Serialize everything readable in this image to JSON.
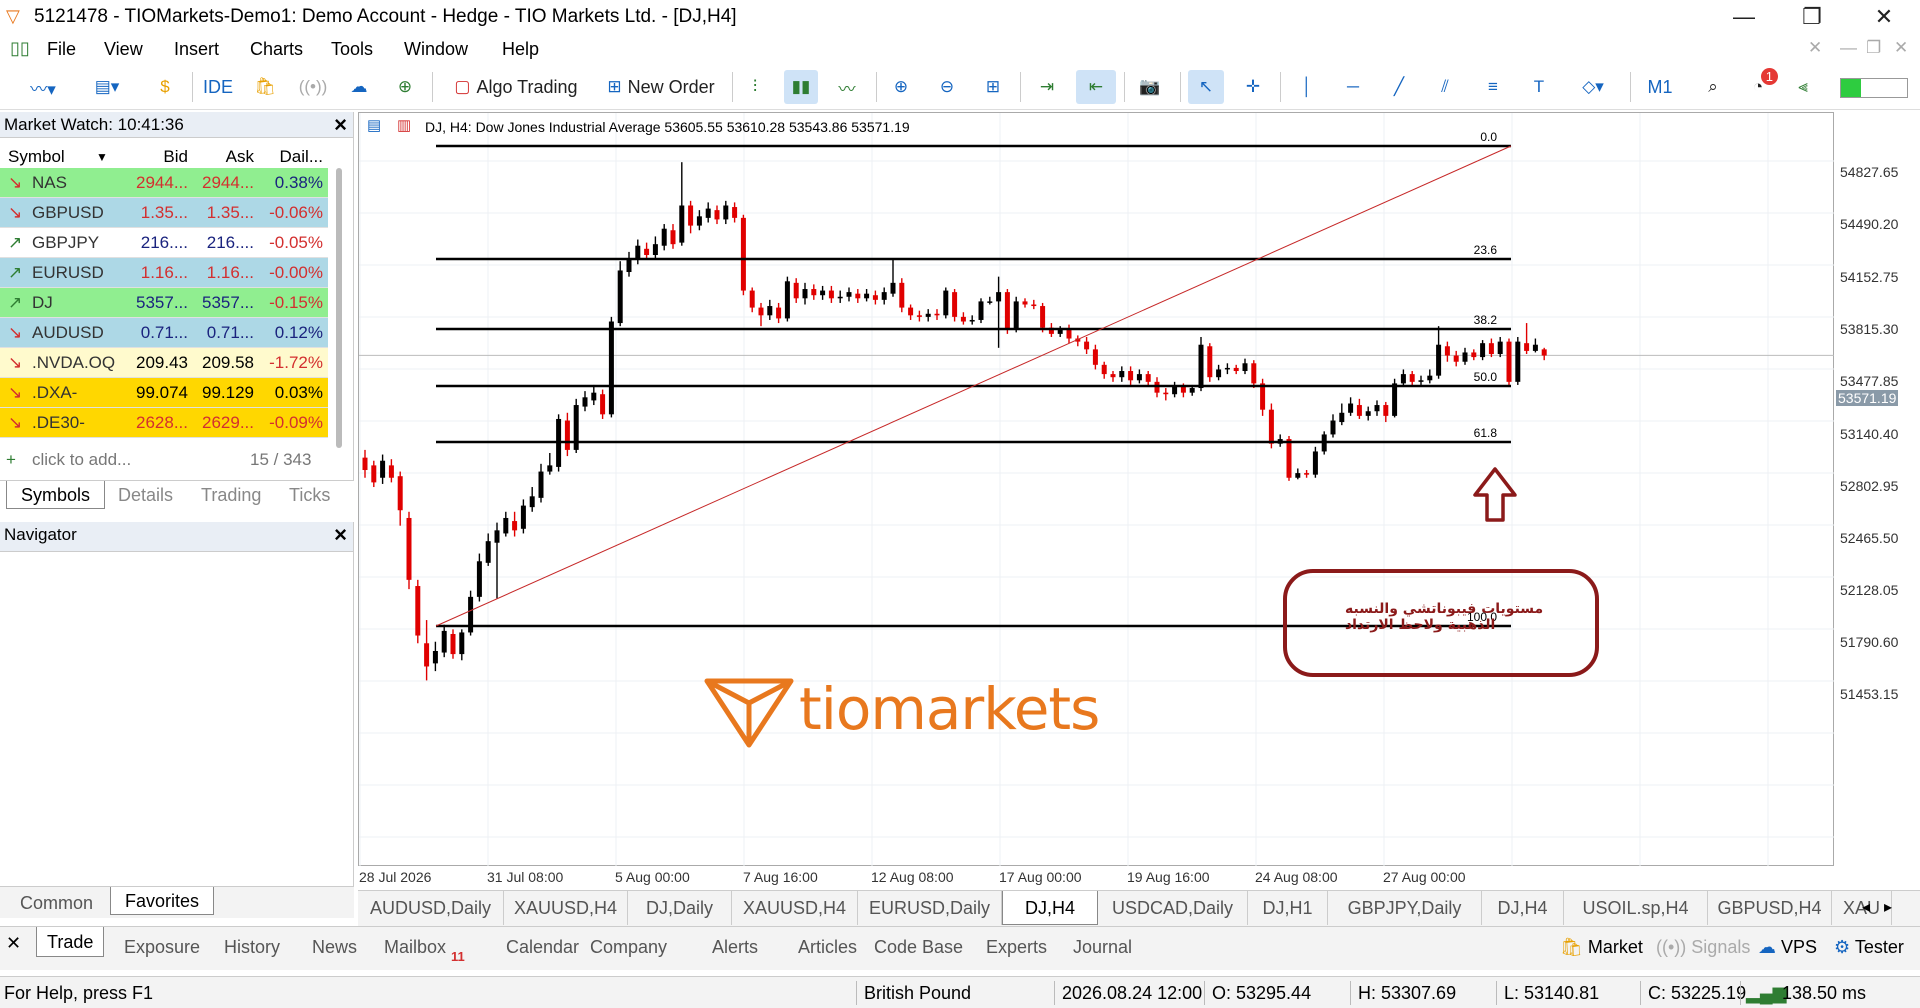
{
  "window": {
    "title": "5121478 - TIOMarkets-Demo1: Demo Account - Hedge - TIO Markets Ltd. - [DJ,H4]"
  },
  "menu": [
    "File",
    "View",
    "Insert",
    "Charts",
    "Tools",
    "Window",
    "Help"
  ],
  "toolbar": {
    "ide_label": "IDE",
    "algo_label": "Algo Trading",
    "new_order_label": "New Order",
    "timeframe": "M1",
    "notif_count": "1"
  },
  "market_watch": {
    "title": "Market Watch: 10:41:36",
    "headers": {
      "symbol": "Symbol",
      "bid": "Bid",
      "ask": "Ask",
      "daily": "Dail..."
    },
    "rows": [
      {
        "symbol": "NAS",
        "bid": "2944...",
        "ask": "2944...",
        "daily": "0.38%",
        "dir": "down",
        "bg": "#90ee90",
        "color": "#d32f2f",
        "dcolor": "#1a237e"
      },
      {
        "symbol": "GBPUSD",
        "bid": "1.35...",
        "ask": "1.35...",
        "daily": "-0.06%",
        "dir": "down",
        "bg": "#add8e6",
        "color": "#d32f2f",
        "dcolor": "#d32f2f"
      },
      {
        "symbol": "GBPJPY",
        "bid": "216....",
        "ask": "216....",
        "daily": "-0.05%",
        "dir": "up",
        "bg": "#ffffff",
        "color": "#1a237e",
        "dcolor": "#d32f2f"
      },
      {
        "symbol": "EURUSD",
        "bid": "1.16...",
        "ask": "1.16...",
        "daily": "-0.00%",
        "dir": "up",
        "bg": "#add8e6",
        "color": "#d32f2f",
        "dcolor": "#d32f2f"
      },
      {
        "symbol": "DJ",
        "bid": "5357...",
        "ask": "5357...",
        "daily": "-0.15%",
        "dir": "up",
        "bg": "#90ee90",
        "color": "#1a237e",
        "dcolor": "#d32f2f"
      },
      {
        "symbol": "AUDUSD",
        "bid": "0.71...",
        "ask": "0.71...",
        "daily": "0.12%",
        "dir": "down",
        "bg": "#add8e6",
        "color": "#1a237e",
        "dcolor": "#1a237e"
      },
      {
        "symbol": ".NVDA.OQ",
        "bid": "209.43",
        "ask": "209.58",
        "daily": "-1.72%",
        "dir": "down",
        "bg": "#fffacd",
        "color": "#000000",
        "dcolor": "#d32f2f"
      },
      {
        "symbol": ".DXA-",
        "bid": "99.074",
        "ask": "99.129",
        "daily": "0.03%",
        "dir": "down",
        "bg": "#ffd700",
        "color": "#000000",
        "dcolor": "#000000"
      },
      {
        "symbol": ".DE30-",
        "bid": "2628...",
        "ask": "2629...",
        "daily": "-0.09%",
        "dir": "down",
        "bg": "#ffd700",
        "color": "#d32f2f",
        "dcolor": "#d32f2f"
      }
    ],
    "add_label": "click to add...",
    "count": "15 / 343",
    "tabs": [
      "Symbols",
      "Details",
      "Trading",
      "Ticks"
    ]
  },
  "navigator": {
    "title": "Navigator",
    "tabs": [
      "Common",
      "Favorites"
    ]
  },
  "chart": {
    "header": "DJ, H4:  Dow Jones Industrial Average  53605.55 53610.28 53543.86 53571.19",
    "price_labels": [
      "54827.65",
      "54490.20",
      "54152.75",
      "53815.30",
      "53477.85",
      "53140.40",
      "52802.95",
      "52465.50",
      "52128.05",
      "51790.60",
      "51453.15"
    ],
    "current_price": "53571.19",
    "time_labels": [
      "28 Jul 2026",
      "31 Jul 08:00",
      "5 Aug 00:00",
      "7 Aug 16:00",
      "12 Aug 08:00",
      "17 Aug 00:00",
      "19 Aug 16:00",
      "24 Aug 08:00",
      "27 Aug 00:00"
    ],
    "fib_levels": [
      "0.0",
      "23.6",
      "38.2",
      "50.0",
      "61.8",
      "100.0"
    ],
    "annotation_line1": "مستويات فيبوناتشي والنسبه",
    "annotation_line2": "الذهبية ولاحظ الارتداد",
    "watermark": "tiomarkets"
  },
  "chart_tabs": [
    "AUDUSD,Daily",
    "XAUUSD,H4",
    "DJ,Daily",
    "XAUUSD,H4",
    "EURUSD,Daily",
    "DJ,H4",
    "USDCAD,Daily",
    "DJ,H1",
    "GBPJPY,Daily",
    "DJ,H4",
    "USOIL.sp,H4",
    "GBPUSD,H4",
    "XAU"
  ],
  "terminal_tabs": [
    "Trade",
    "Exposure",
    "History",
    "News",
    "Mailbox",
    "Calendar",
    "Company",
    "Alerts",
    "Articles",
    "Code Base",
    "Experts",
    "Journal"
  ],
  "mailbox_count": "11",
  "terminal_right": {
    "market": "Market",
    "signals": "Signals",
    "vps": "VPS",
    "tester": "Tester"
  },
  "status": {
    "help": "For Help, press F1",
    "profile": "British Pound",
    "datetime": "2026.08.24 12:00",
    "open": "O: 53295.44",
    "high": "H: 53307.69",
    "low": "L: 53140.81",
    "close": "C: 53225.19",
    "ping": "138.50 ms"
  },
  "colors": {
    "bull": "#000000",
    "bear": "#e00000",
    "fib": "#000000",
    "trend": "#c62828",
    "annot": "#8b1a1a",
    "accent": "#e8781e"
  }
}
